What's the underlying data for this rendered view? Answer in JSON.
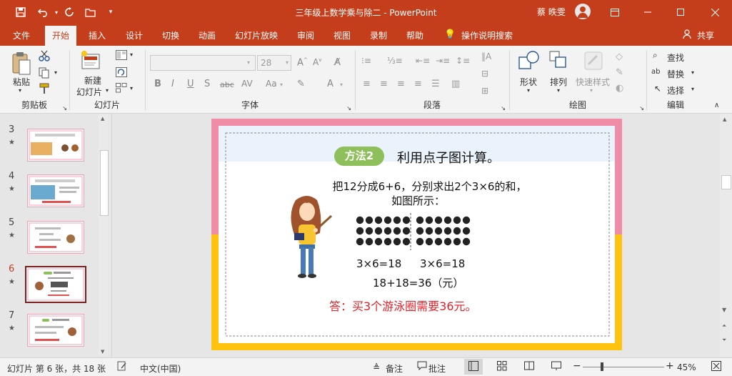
{
  "window": {
    "title": "三年级上数学乘与除二  -  PowerPoint",
    "user": "蔡 昳雯"
  },
  "tabs": [
    {
      "label": "文件"
    },
    {
      "label": "开始"
    },
    {
      "label": "插入"
    },
    {
      "label": "设计"
    },
    {
      "label": "切换"
    },
    {
      "label": "动画"
    },
    {
      "label": "幻灯片放映"
    },
    {
      "label": "审阅"
    },
    {
      "label": "视图"
    },
    {
      "label": "录制"
    },
    {
      "label": "帮助"
    },
    {
      "label": "操作说明搜索"
    }
  ],
  "share_label": "共享",
  "ribbon": {
    "clipboard": {
      "paste": "粘贴",
      "group": "剪贴板"
    },
    "slides": {
      "new_slide_1": "新建",
      "new_slide_2": "幻灯片",
      "group": "幻灯片"
    },
    "font": {
      "size": "28",
      "group": "字体"
    },
    "paragraph": {
      "group": "段落"
    },
    "drawing": {
      "shape": "形状",
      "arrange": "排列",
      "quick_styles": "快速样式",
      "group": "绘图"
    },
    "editing": {
      "find": "查找",
      "replace": "替换",
      "select": "选择",
      "group": "编辑"
    }
  },
  "thumbnails": [
    {
      "num": "3",
      "star": "★",
      "active": false
    },
    {
      "num": "4",
      "star": "★",
      "active": false
    },
    {
      "num": "5",
      "star": "★",
      "active": false
    },
    {
      "num": "6",
      "star": "★",
      "active": true
    },
    {
      "num": "7",
      "star": "★",
      "active": false
    }
  ],
  "slide": {
    "badge": "方法2",
    "heading": "利用点子图计算。",
    "line1": "把12分成6+6，分别求出2个3×6的和，",
    "line2": "如图所示：",
    "eq1": "3×6=18",
    "eq2": "3×6=18",
    "eq3": "18+18=36（元）",
    "answer": "答：买3个游泳圈需要36元。"
  },
  "status": {
    "slide_info": "幻灯片 第 6 张，共 18 张",
    "language": "中文(中国)",
    "notes": "备注",
    "comments": "批注",
    "zoom": "45%"
  }
}
